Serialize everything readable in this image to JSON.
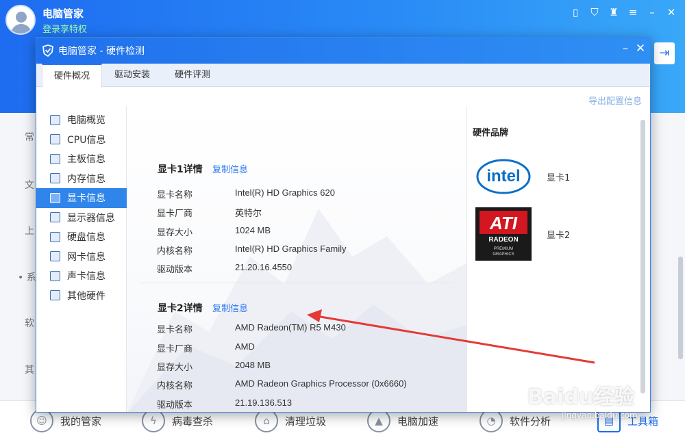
{
  "app": {
    "name": "电脑管家",
    "login_text": "登录享特权"
  },
  "background": {
    "left_labels": [
      "常",
      "文",
      "上",
      "• 系",
      "软",
      "其"
    ],
    "bottom_nav": [
      {
        "label": "我的管家",
        "icon": "shield-face-icon"
      },
      {
        "label": "病毒查杀",
        "icon": "lightning-icon"
      },
      {
        "label": "清理垃圾",
        "icon": "broom-icon"
      },
      {
        "label": "电脑加速",
        "icon": "rocket-icon"
      },
      {
        "label": "软件分析",
        "icon": "gauge-icon"
      },
      {
        "label": "工具箱",
        "icon": "toolbox-icon"
      }
    ]
  },
  "dialog": {
    "title": "电脑管家 - 硬件检测",
    "tabs": [
      "硬件概况",
      "驱动安装",
      "硬件评测"
    ],
    "active_tab": "硬件概况",
    "export_link": "导出配置信息",
    "sidebar": [
      {
        "label": "电脑概览",
        "active": false
      },
      {
        "label": "CPU信息",
        "active": false
      },
      {
        "label": "主板信息",
        "active": false
      },
      {
        "label": "内存信息",
        "active": false
      },
      {
        "label": "显卡信息",
        "active": true
      },
      {
        "label": "显示器信息",
        "active": false
      },
      {
        "label": "硬盘信息",
        "active": false
      },
      {
        "label": "网卡信息",
        "active": false
      },
      {
        "label": "声卡信息",
        "active": false
      },
      {
        "label": "其他硬件",
        "active": false
      }
    ],
    "gpu1": {
      "title": "显卡1详情",
      "copy": "复制信息",
      "rows": [
        {
          "key": "显卡名称",
          "value": "Intel(R) HD Graphics 620"
        },
        {
          "key": "显卡厂商",
          "value": "英特尔"
        },
        {
          "key": "显存大小",
          "value": "1024 MB"
        },
        {
          "key": "内核名称",
          "value": "Intel(R) HD Graphics Family"
        },
        {
          "key": "驱动版本",
          "value": "21.20.16.4550"
        }
      ]
    },
    "gpu2": {
      "title": "显卡2详情",
      "copy": "复制信息",
      "rows": [
        {
          "key": "显卡名称",
          "value": "AMD Radeon(TM) R5 M430"
        },
        {
          "key": "显卡厂商",
          "value": "AMD"
        },
        {
          "key": "显存大小",
          "value": "2048 MB"
        },
        {
          "key": "内核名称",
          "value": "AMD Radeon Graphics Processor (0x6660)"
        },
        {
          "key": "驱动版本",
          "value": "21.19.136.513"
        }
      ]
    },
    "brands": {
      "title": "硬件品牌",
      "items": [
        {
          "label": "显卡1",
          "logo_text": "intel"
        },
        {
          "label": "显卡2",
          "logo_text": "ATI",
          "logo_sub": "RADEON",
          "logo_sub2": "PREMIUM",
          "logo_sub3": "GRAPHICS"
        }
      ]
    }
  },
  "watermark": {
    "text": "Baidu经验",
    "sub": "jingyan.baidu.com"
  },
  "colors": {
    "accent": "#2a78f0",
    "arrow": "#e53935"
  }
}
